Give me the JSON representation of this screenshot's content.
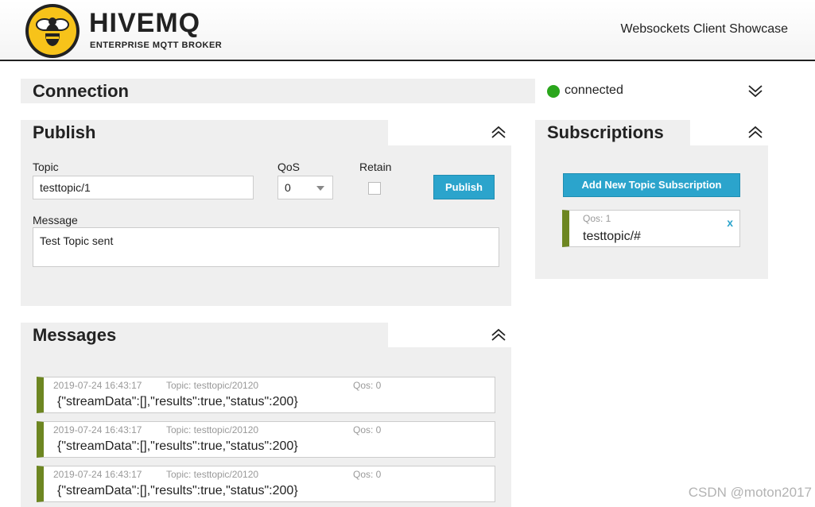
{
  "header": {
    "brand": "HIVEMQ",
    "brand_sub": "ENTERPRISE MQTT BROKER",
    "title": "Websockets Client Showcase"
  },
  "connection": {
    "title": "Connection",
    "status": "connected",
    "status_color": "#2aa61c"
  },
  "publish": {
    "title": "Publish",
    "topic_label": "Topic",
    "topic_value": "testtopic/1",
    "qos_label": "QoS",
    "qos_value": "0",
    "retain_label": "Retain",
    "publish_button": "Publish",
    "message_label": "Message",
    "message_value": "Test Topic sent"
  },
  "messages": {
    "title": "Messages",
    "items": [
      {
        "timestamp": "2019-07-24 16:43:17",
        "topic": "Topic: testtopic/20120",
        "qos": "Qos: 0",
        "payload": "{\"streamData\":[],\"results\":true,\"status\":200}"
      },
      {
        "timestamp": "2019-07-24 16:43:17",
        "topic": "Topic: testtopic/20120",
        "qos": "Qos: 0",
        "payload": "{\"streamData\":[],\"results\":true,\"status\":200}"
      },
      {
        "timestamp": "2019-07-24 16:43:17",
        "topic": "Topic: testtopic/20120",
        "qos": "Qos: 0",
        "payload": "{\"streamData\":[],\"results\":true,\"status\":200}"
      }
    ]
  },
  "subscriptions": {
    "title": "Subscriptions",
    "add_button": "Add New Topic Subscription",
    "items": [
      {
        "qos": "Qos: 1",
        "topic": "testtopic/#",
        "remove": "x"
      }
    ]
  },
  "watermark": "CSDN @moton2017",
  "icons": {
    "logo": "bee-logo-icon",
    "collapse": "chevron-double-up-icon",
    "expand": "chevron-double-down-icon"
  },
  "colors": {
    "accent": "#2ba4cc",
    "item_bar": "#6d8621",
    "panel_bg": "#efefef"
  }
}
